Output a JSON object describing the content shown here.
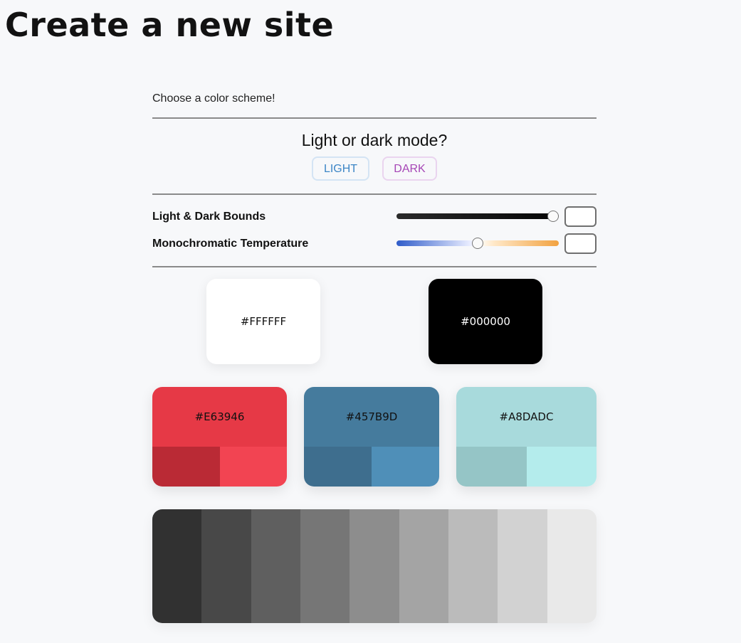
{
  "header": {
    "title": "Create a new site"
  },
  "intro": {
    "text": "Choose a color scheme!"
  },
  "mode": {
    "question": "Light or dark mode?",
    "light_label": "LIGHT",
    "dark_label": "DARK"
  },
  "controls": {
    "bounds_label": "Light & Dark Bounds",
    "bounds_value": "",
    "temperature_label": "Monochromatic Temperature",
    "temperature_value": ""
  },
  "bounds_swatches": {
    "light": {
      "hex": "#FFFFFF",
      "bg": "#FFFFFF",
      "text_color": "#111111"
    },
    "dark": {
      "hex": "#000000",
      "bg": "#000000",
      "text_color": "#FFFFFF"
    }
  },
  "palette": [
    {
      "hex": "#E63946",
      "bg": "#E63946",
      "shade_dark": "#BA2A35",
      "shade_light": "#F24452"
    },
    {
      "hex": "#457B9D",
      "bg": "#457B9D",
      "shade_dark": "#3E6E8E",
      "shade_light": "#4F8FB8"
    },
    {
      "hex": "#A8DADC",
      "bg": "#A8DADC",
      "shade_dark": "#95C5C6",
      "shade_light": "#B4ECEC"
    }
  ],
  "monochrome": [
    "#313131",
    "#484848",
    "#5F5F5F",
    "#767676",
    "#8D8D8D",
    "#A4A4A4",
    "#BBBBBB",
    "#D2D2D2",
    "#E9E9E9"
  ],
  "colors": {
    "light_accent": "#3D86C6",
    "dark_accent": "#A646B6"
  }
}
